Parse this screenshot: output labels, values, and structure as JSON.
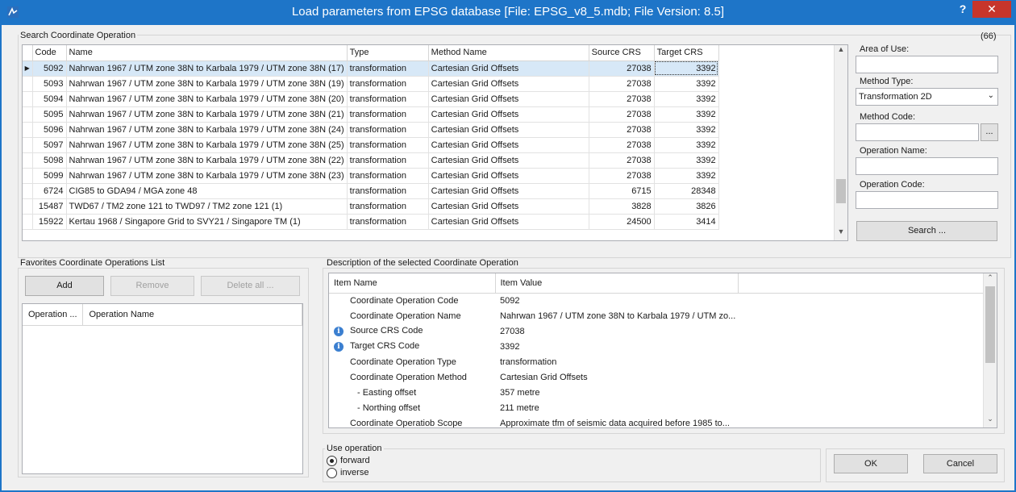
{
  "window": {
    "title": "Load parameters from EPSG database [File: EPSG_v8_5.mdb; File Version: 8.5]",
    "help": "?",
    "close": "✕"
  },
  "search": {
    "group_label": "Search Coordinate Operation",
    "count": "(66)",
    "columns": [
      "Code",
      "Name",
      "Type",
      "Method Name",
      "Source CRS",
      "Target CRS"
    ],
    "rows": [
      {
        "code": "5092",
        "name": "Nahrwan 1967 / UTM zone 38N to Karbala 1979 / UTM zone 38N (17)",
        "type": "transformation",
        "method": "Cartesian Grid Offsets",
        "source": "27038",
        "target": "3392"
      },
      {
        "code": "5093",
        "name": "Nahrwan 1967 / UTM zone 38N to Karbala 1979 / UTM zone 38N (19)",
        "type": "transformation",
        "method": "Cartesian Grid Offsets",
        "source": "27038",
        "target": "3392"
      },
      {
        "code": "5094",
        "name": "Nahrwan 1967 / UTM zone 38N to Karbala 1979 / UTM zone 38N (20)",
        "type": "transformation",
        "method": "Cartesian Grid Offsets",
        "source": "27038",
        "target": "3392"
      },
      {
        "code": "5095",
        "name": "Nahrwan 1967 / UTM zone 38N to Karbala 1979 / UTM zone 38N (21)",
        "type": "transformation",
        "method": "Cartesian Grid Offsets",
        "source": "27038",
        "target": "3392"
      },
      {
        "code": "5096",
        "name": "Nahrwan 1967 / UTM zone 38N to Karbala 1979 / UTM zone 38N (24)",
        "type": "transformation",
        "method": "Cartesian Grid Offsets",
        "source": "27038",
        "target": "3392"
      },
      {
        "code": "5097",
        "name": "Nahrwan 1967 / UTM zone 38N to Karbala 1979 / UTM zone 38N (25)",
        "type": "transformation",
        "method": "Cartesian Grid Offsets",
        "source": "27038",
        "target": "3392"
      },
      {
        "code": "5098",
        "name": "Nahrwan 1967 / UTM zone 38N to Karbala 1979 / UTM zone 38N (22)",
        "type": "transformation",
        "method": "Cartesian Grid Offsets",
        "source": "27038",
        "target": "3392"
      },
      {
        "code": "5099",
        "name": "Nahrwan 1967 / UTM zone 38N to Karbala 1979 / UTM zone 38N (23)",
        "type": "transformation",
        "method": "Cartesian Grid Offsets",
        "source": "27038",
        "target": "3392"
      },
      {
        "code": "6724",
        "name": "CIG85 to GDA94 / MGA zone 48",
        "type": "transformation",
        "method": "Cartesian Grid Offsets",
        "source": "6715",
        "target": "28348"
      },
      {
        "code": "15487",
        "name": "TWD67 / TM2 zone 121 to TWD97 / TM2 zone 121 (1)",
        "type": "transformation",
        "method": "Cartesian Grid Offsets",
        "source": "3828",
        "target": "3826"
      },
      {
        "code": "15922",
        "name": "Kertau 1968 / Singapore Grid to SVY21 / Singapore TM (1)",
        "type": "transformation",
        "method": "Cartesian Grid Offsets",
        "source": "24500",
        "target": "3414"
      }
    ]
  },
  "filters": {
    "area_label": "Area of Use:",
    "area_value": "",
    "method_type_label": "Method Type:",
    "method_type_value": "Transformation 2D",
    "method_code_label": "Method Code:",
    "method_code_value": "",
    "browse_label": "...",
    "op_name_label": "Operation Name:",
    "op_name_value": "",
    "op_code_label": "Operation Code:",
    "op_code_value": "",
    "search_button": "Search ..."
  },
  "favorites": {
    "group_label": "Favorites Coordinate Operations List",
    "add": "Add",
    "remove": "Remove",
    "delete_all": "Delete all ...",
    "columns": [
      "Operation ...",
      "Operation Name"
    ]
  },
  "description": {
    "group_label": "Description of the selected Coordinate Operation",
    "columns": [
      "Item Name",
      "Item Value"
    ],
    "items": [
      {
        "name": "Coordinate Operation Code",
        "value": "5092",
        "info": false,
        "indent": false
      },
      {
        "name": "Coordinate Operation Name",
        "value": "Nahrwan 1967 / UTM zone 38N to Karbala 1979 / UTM zo...",
        "info": false,
        "indent": false
      },
      {
        "name": "Source CRS Code",
        "value": "27038",
        "info": true,
        "indent": false
      },
      {
        "name": "Target CRS Code",
        "value": "3392",
        "info": true,
        "indent": false
      },
      {
        "name": "Coordinate Operation Type",
        "value": "transformation",
        "info": false,
        "indent": false
      },
      {
        "name": "Coordinate Operation Method",
        "value": "Cartesian Grid Offsets",
        "info": false,
        "indent": false
      },
      {
        "name": "- Easting offset",
        "value": "357 metre",
        "info": false,
        "indent": true
      },
      {
        "name": "- Northing offset",
        "value": "211 metre",
        "info": false,
        "indent": true
      },
      {
        "name": "Coordinate Operatiob Scope",
        "value": "Approximate tfm of seismic data acquired before 1985 to...",
        "info": false,
        "indent": false
      }
    ]
  },
  "use_operation": {
    "group_label": "Use operation",
    "forward": "forward",
    "inverse": "inverse",
    "selected": "forward"
  },
  "dialog": {
    "ok": "OK",
    "cancel": "Cancel"
  },
  "colors": {
    "title_bar": "#1e75c8",
    "close_button": "#c7352b",
    "selection": "#d7e8f7"
  }
}
